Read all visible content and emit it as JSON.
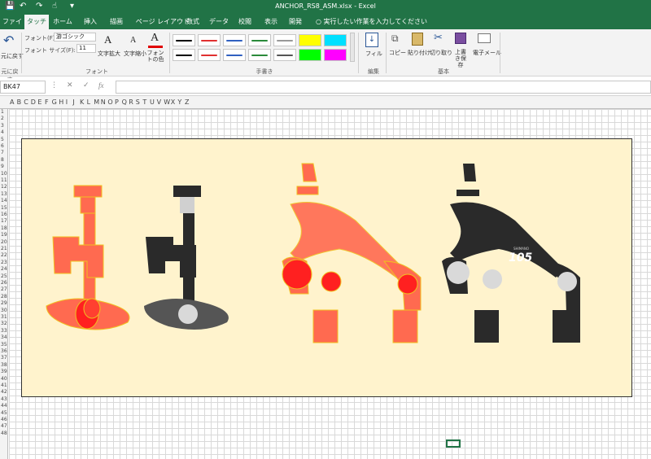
{
  "window": {
    "title": "ANCHOR_RS8_ASM.xlsx - Excel"
  },
  "tabs": [
    {
      "label": "ファイル",
      "active": false
    },
    {
      "label": "タッチ",
      "active": true
    },
    {
      "label": "ホーム",
      "active": false
    },
    {
      "label": "挿入",
      "active": false
    },
    {
      "label": "描画",
      "active": false
    },
    {
      "label": "ページ レイアウト",
      "active": false
    },
    {
      "label": "数式",
      "active": false
    },
    {
      "label": "データ",
      "active": false
    },
    {
      "label": "校閲",
      "active": false
    },
    {
      "label": "表示",
      "active": false
    },
    {
      "label": "開発",
      "active": false
    }
  ],
  "tellme": {
    "text": "実行したい作業を入力してください"
  },
  "ribbon": {
    "undo": {
      "label": "元に戻す",
      "group": "元に戻す"
    },
    "font": {
      "font_label": "フォント(F):",
      "font_value": "游ゴシック",
      "size_label": "フォント サイズ(F):",
      "size_value": "11",
      "grow": "文字拡大",
      "shrink": "文字縮小",
      "color": "フォントの色",
      "group": "フォント"
    },
    "pens": {
      "group": "手書き",
      "colors": [
        "#000000",
        "#e03030",
        "#3060c0",
        "#2a8a3a",
        "#999999",
        "#ffff00",
        "#00e0ff",
        "#000000",
        "#e03030",
        "#3060c0",
        "#2a8a3a",
        "#555555",
        "#00ff00",
        "#ff00ff"
      ]
    },
    "edit": {
      "fill": "フィル",
      "group": "編集"
    },
    "basic": {
      "copy": "コピー",
      "paste": "貼り付け",
      "cut": "切り取り",
      "save": "上書き保存",
      "mail": "電子メール",
      "group": "基本"
    }
  },
  "formula_bar": {
    "name_box": "BK47",
    "fx": "fx"
  },
  "sheet": {
    "row_numbers": [
      "1",
      "2",
      "3",
      "4",
      "5",
      "6",
      "7",
      "8",
      "9",
      "10",
      "11",
      "12",
      "13",
      "14",
      "15",
      "16",
      "17",
      "18",
      "19",
      "20",
      "21",
      "22",
      "23",
      "24",
      "25",
      "26",
      "27",
      "28",
      "29",
      "30",
      "31",
      "32",
      "33",
      "34",
      "35",
      "36",
      "37",
      "38",
      "39",
      "40",
      "41",
      "42",
      "43",
      "44",
      "45",
      "46",
      "47",
      "48"
    ],
    "col_letters": [
      "A",
      "B",
      "C",
      "D",
      "E",
      "F",
      "G",
      "H",
      "I",
      "J",
      "K",
      "L",
      "M",
      "N",
      "O",
      "P",
      "Q",
      "R",
      "S",
      "T",
      "U",
      "V",
      "W",
      "X",
      "Y",
      "Z"
    ]
  },
  "drawing": {
    "logo": "105",
    "brand": "SHIMANO",
    "colors": {
      "bg": "#fff3cd",
      "red": "#ff6a50",
      "dark": "#2a2a2a",
      "grey": "#555555"
    }
  }
}
